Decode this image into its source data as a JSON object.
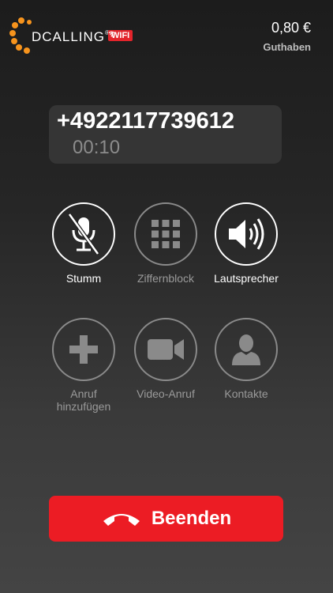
{
  "brand": {
    "name": "DCALLING",
    "registered": "®",
    "wifi_badge": "WIFI"
  },
  "credit": {
    "amount": "0,80 €",
    "label": "Guthaben"
  },
  "call": {
    "number": "+4922117739612",
    "duration": "00:10"
  },
  "buttons": [
    {
      "label": "Stumm",
      "icon": "mute-microphone-icon",
      "active": true
    },
    {
      "label": "Ziffernblock",
      "icon": "keypad-icon",
      "active": false
    },
    {
      "label": "Lautsprecher",
      "icon": "speaker-icon",
      "active": true
    },
    {
      "label": "Anruf\nhinzufügen",
      "icon": "plus-icon",
      "active": false
    },
    {
      "label": "Video-Anruf",
      "icon": "video-camera-icon",
      "active": false
    },
    {
      "label": "Kontakte",
      "icon": "contact-person-icon",
      "active": false
    }
  ],
  "end_call": {
    "label": "Beenden",
    "icon": "hangup-phone-icon"
  },
  "colors": {
    "end_button": "#ec1c24",
    "logo_orange": "#f7941d",
    "inactive": "#8a8a8a"
  }
}
